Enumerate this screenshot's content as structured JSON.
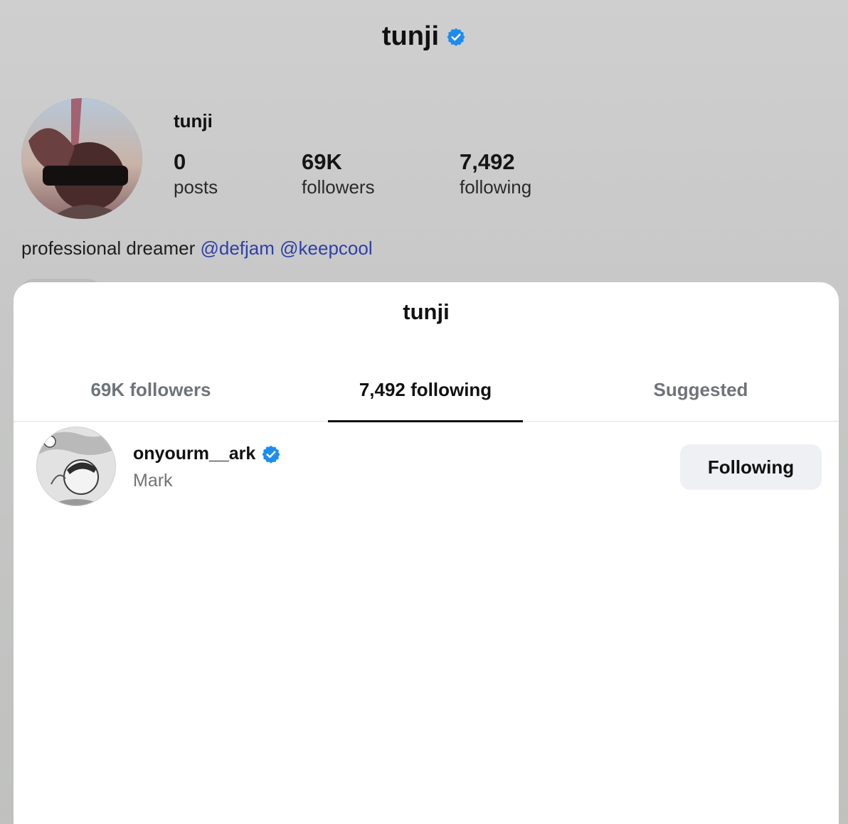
{
  "header": {
    "title": "tunji",
    "verified_icon": "verified-badge-icon",
    "accent": "#1d8cf0"
  },
  "profile": {
    "name": "tunji",
    "stats": [
      {
        "value": "0",
        "label": "posts"
      },
      {
        "value": "69K",
        "label": "followers"
      },
      {
        "value": "7,492",
        "label": "following"
      }
    ],
    "bio_text": "professional dreamer",
    "bio_mentions": [
      "@defjam",
      "@keepcool"
    ],
    "mention_color": "#2f3fa7"
  },
  "sheet": {
    "title": "tunji",
    "tabs": [
      {
        "label": "69K followers",
        "active": false
      },
      {
        "label": "7,492 following",
        "active": true
      },
      {
        "label": "Suggested",
        "active": false
      }
    ],
    "list": [
      {
        "username": "onyourm__ark",
        "verified": true,
        "full_name": "Mark",
        "button": "Following"
      }
    ]
  }
}
